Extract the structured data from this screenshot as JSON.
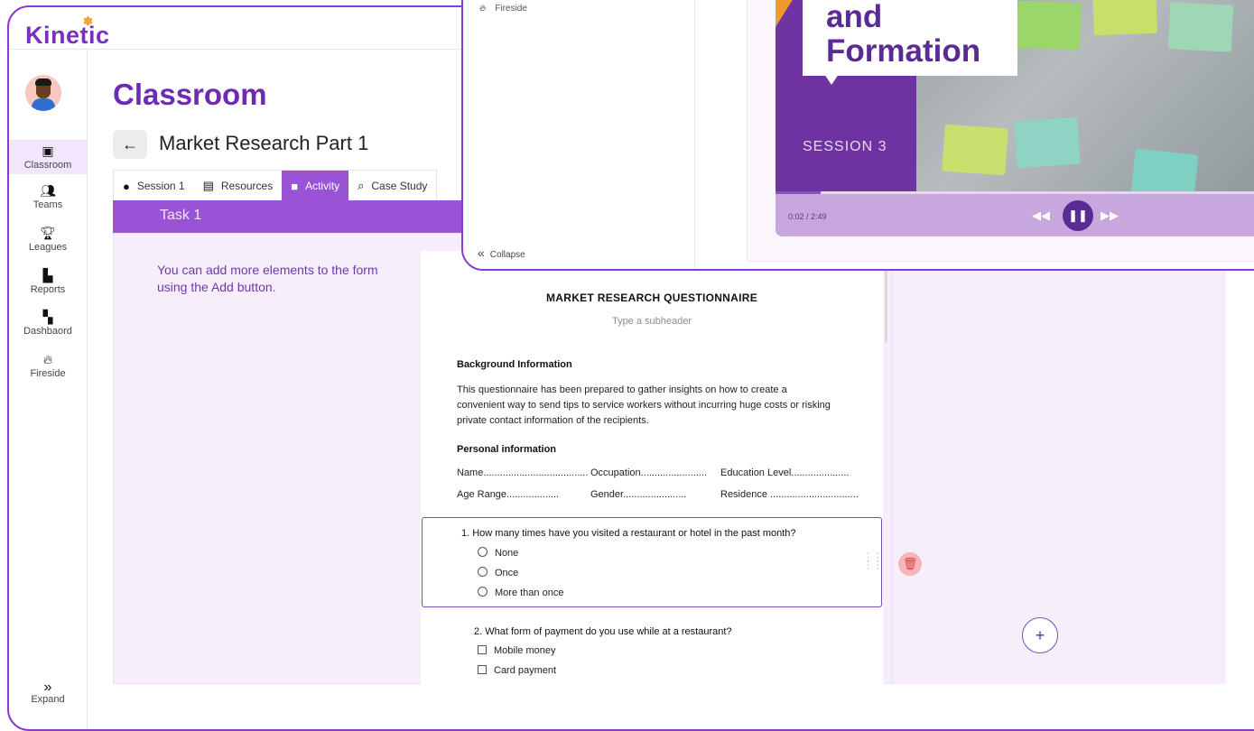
{
  "app": {
    "brand": "Kinetic"
  },
  "sidebar": {
    "items": [
      {
        "label": "Classroom",
        "icon": "monitor-play-icon",
        "active": true
      },
      {
        "label": "Teams",
        "icon": "people-icon"
      },
      {
        "label": "Leagues",
        "icon": "trophy-icon"
      },
      {
        "label": "Reports",
        "icon": "report-icon"
      },
      {
        "label": "Dashbaord",
        "icon": "dashboard-grid-icon"
      },
      {
        "label": "Fireside",
        "icon": "flame-icon"
      }
    ],
    "expand_label": "Expand"
  },
  "page": {
    "title": "Classroom",
    "subtitle": "Market Research Part 1"
  },
  "tabs": [
    {
      "label": "Session 1",
      "icon": "play-circle-icon"
    },
    {
      "label": "Resources",
      "icon": "book-icon"
    },
    {
      "label": "Activity",
      "icon": "briefcase-icon",
      "active": true
    },
    {
      "label": "Case Study",
      "icon": "search-icon"
    }
  ],
  "task": {
    "label": "Task 1"
  },
  "hint": "You can add more elements to the form using the Add button.",
  "form": {
    "title": "MARKET RESEARCH QUESTIONNAIRE",
    "subheader_placeholder": "Type a subheader",
    "background_heading": "Background Information",
    "background_text": "This questionnaire has been prepared to gather insights on how to create a convenient way to send tips to service workers without incurring huge costs or risking private contact information of the recipients.",
    "personal_heading": "Personal information",
    "fields": {
      "name": "Name......................................",
      "occupation": "Occupation........................",
      "education": "Education Level.....................",
      "age": "Age Range...................",
      "gender": "Gender.......................",
      "residence": "Residence ................................"
    },
    "q1": {
      "text": "1. How many times have you visited a restaurant or hotel in the past month?",
      "options": [
        "None",
        "Once",
        "More than once"
      ]
    },
    "q2": {
      "text": "2. What form of payment do you use while at a restaurant?",
      "options": [
        "Mobile money",
        "Card payment"
      ]
    }
  },
  "overlay": {
    "nav_label": "Fireside",
    "collapse_label": "Collapse",
    "video": {
      "callout_line1": "and",
      "callout_line2": "Formation",
      "session_label": "SESSION 3",
      "time": "0:02 / 2:49",
      "progress": 0.012
    }
  },
  "colors": {
    "primary": "#7b2fbf",
    "tab_active": "#9a52d6",
    "content_bg": "#f7eefc",
    "delete": "#e0404a"
  }
}
